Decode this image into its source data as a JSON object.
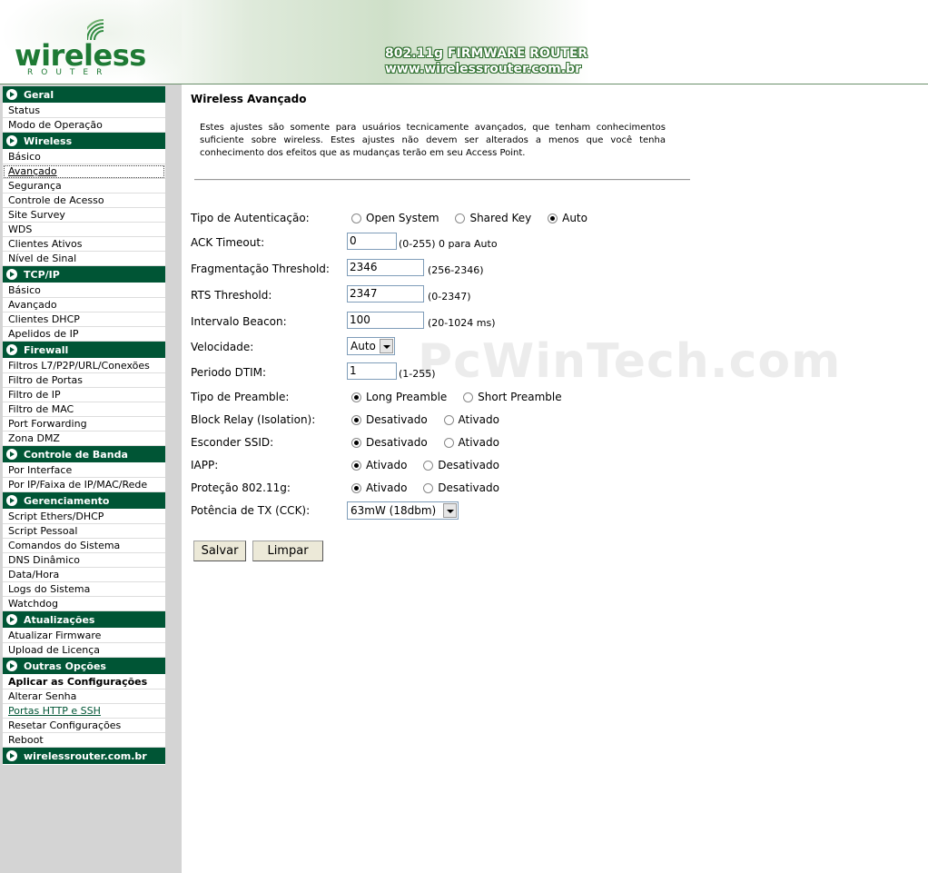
{
  "header": {
    "logo_text": "wireless",
    "logo_sub": "ROUTER",
    "title": "802.11g FIRMWARE ROUTER",
    "url": "www.wirelessrouter.com.br"
  },
  "sidebar": {
    "sections": [
      {
        "title": "Geral",
        "items": [
          "Status",
          "Modo de Operação"
        ]
      },
      {
        "title": "Wireless",
        "items": [
          "Básico",
          "Avançado",
          "Segurança",
          "Controle de Acesso",
          "Site Survey",
          "WDS",
          "Clientes Ativos",
          "Nível de Sinal"
        ]
      },
      {
        "title": "TCP/IP",
        "items": [
          "Básico",
          "Avançado",
          "Clientes DHCP",
          "Apelidos de IP"
        ]
      },
      {
        "title": "Firewall",
        "items": [
          "Filtros L7/P2P/URL/Conexões",
          "Filtro de Portas",
          "Filtro de IP",
          "Filtro de MAC",
          "Port Forwarding",
          "Zona DMZ"
        ]
      },
      {
        "title": "Controle de Banda",
        "items": [
          "Por Interface",
          "Por IP/Faixa de IP/MAC/Rede"
        ]
      },
      {
        "title": "Gerenciamento",
        "items": [
          "Script Ethers/DHCP",
          "Script Pessoal",
          "Comandos do Sistema",
          "DNS Dinâmico",
          "Data/Hora",
          "Logs do Sistema",
          "Watchdog"
        ]
      },
      {
        "title": "Atualizações",
        "items": [
          "Atualizar Firmware",
          "Upload de Licença"
        ]
      },
      {
        "title": "Outras Opções",
        "items": [
          "Aplicar as Configurações",
          "Alterar Senha",
          "Portas HTTP e SSH",
          "Resetar Configurações",
          "Reboot"
        ]
      },
      {
        "title": "wirelessrouter.com.br",
        "items": []
      }
    ]
  },
  "main": {
    "title": "Wireless Avançado",
    "description": "Estes ajustes são somente para usuários tecnicamente avançados, que tenham conhecimentos suficiente sobre wireless. Estes ajustes não devem ser alterados a menos que você tenha conhecimento dos efeitos que as mudanças terão em seu Access Point.",
    "watermark": "PcWinTech.com",
    "auth": {
      "label": "Tipo de Autenticação:",
      "opt1": "Open System",
      "opt2": "Shared Key",
      "opt3": "Auto"
    },
    "ack": {
      "label": "ACK Timeout:",
      "value": "0",
      "hint": "(0-255) 0 para Auto"
    },
    "frag": {
      "label": "Fragmentação Threshold:",
      "value": "2346",
      "hint": "(256-2346)"
    },
    "rts": {
      "label": "RTS Threshold:",
      "value": "2347",
      "hint": "(0-2347)"
    },
    "beacon": {
      "label": "Intervalo Beacon:",
      "value": "100",
      "hint": "(20-1024 ms)"
    },
    "speed": {
      "label": "Velocidade:",
      "value": "Auto"
    },
    "dtim": {
      "label": "Periodo DTIM:",
      "value": "1",
      "hint": "(1-255)"
    },
    "preamble": {
      "label": "Tipo de Preamble:",
      "opt1": "Long Preamble",
      "opt2": "Short Preamble"
    },
    "relay": {
      "label": "Block Relay (Isolation):",
      "opt1": "Desativado",
      "opt2": "Ativado"
    },
    "ssid": {
      "label": "Esconder SSID:",
      "opt1": "Desativado",
      "opt2": "Ativado"
    },
    "iapp": {
      "label": "IAPP:",
      "opt1": "Ativado",
      "opt2": "Desativado"
    },
    "prot": {
      "label": "Proteção 802.11g:",
      "opt1": "Ativado",
      "opt2": "Desativado"
    },
    "txpower": {
      "label": "Potência de TX (CCK):",
      "value": "63mW (18dbm)"
    },
    "buttons": {
      "save": "Salvar",
      "clear": "Limpar"
    }
  }
}
